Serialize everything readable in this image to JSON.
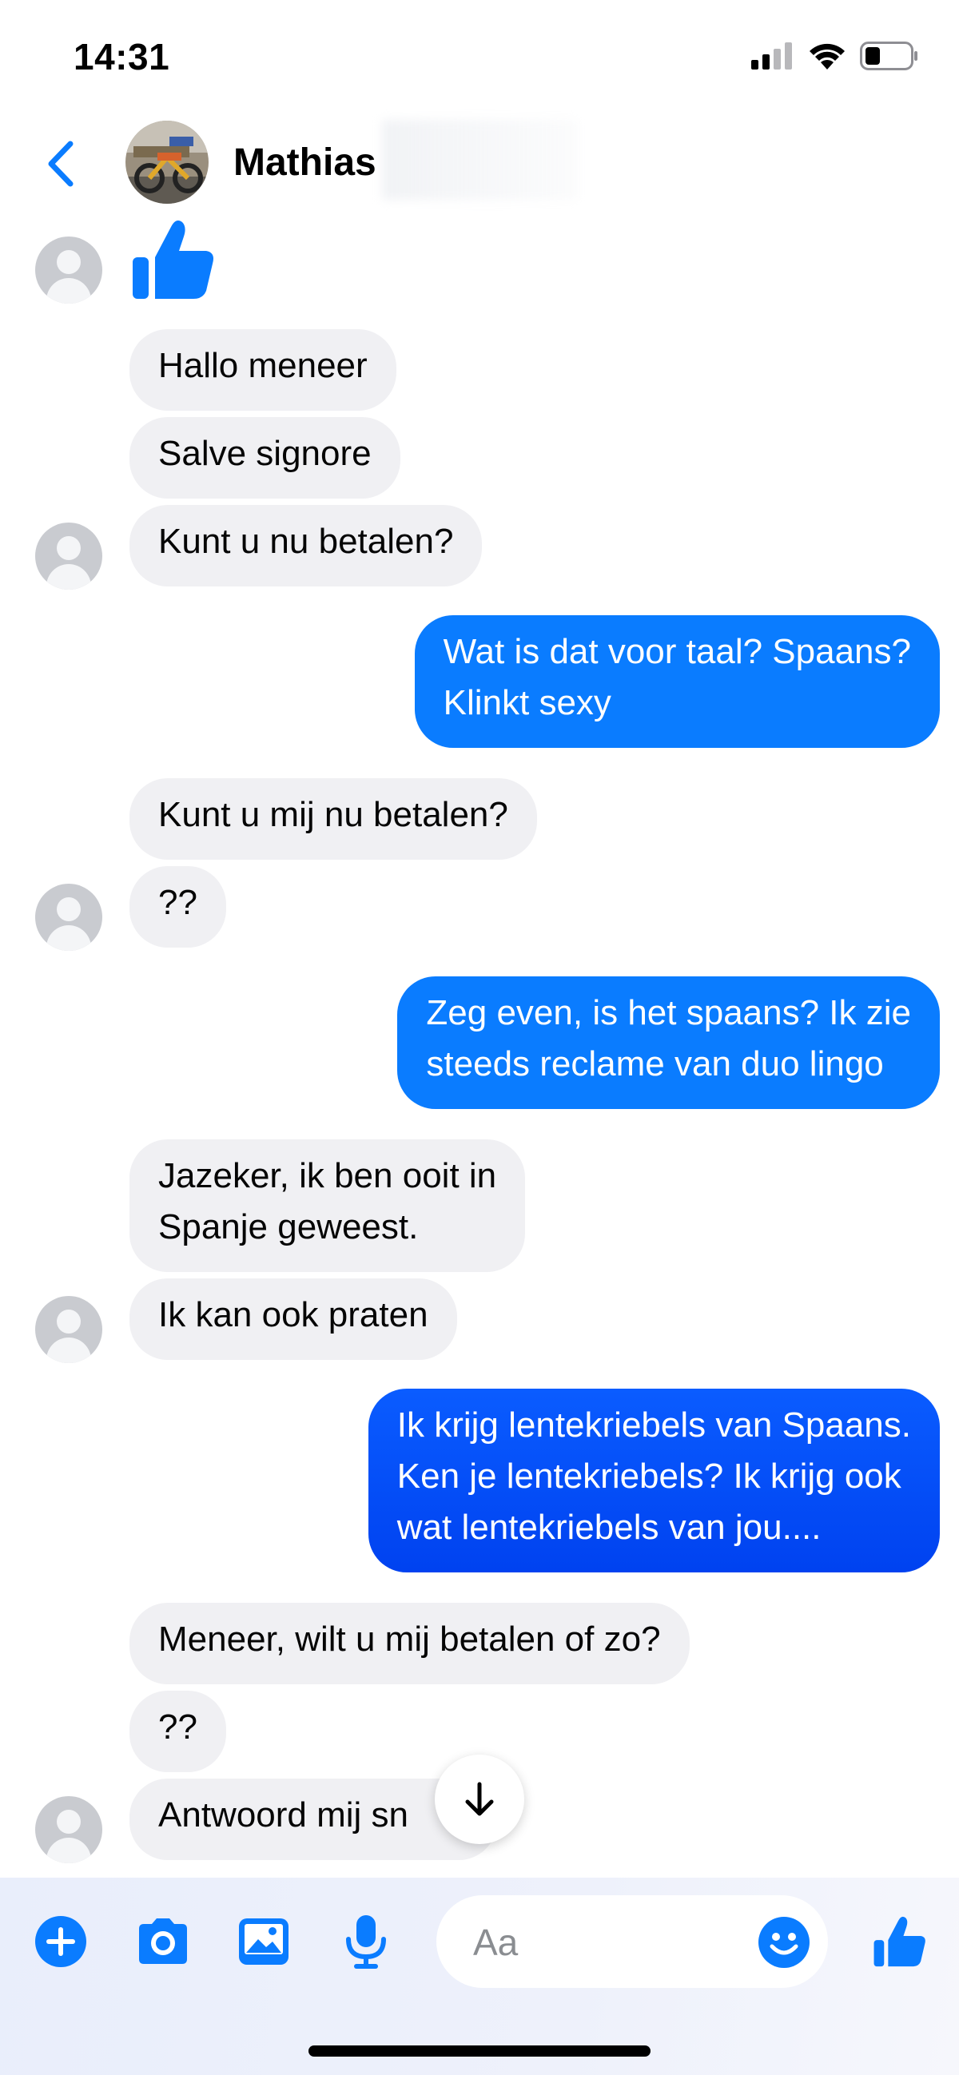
{
  "status_bar": {
    "time": "14:31"
  },
  "header": {
    "contact_name": "Mathias"
  },
  "messages": [
    {
      "side": "in",
      "text": "Hallo meneer"
    },
    {
      "side": "in",
      "text": "Salve signore"
    },
    {
      "side": "in",
      "text": "Kunt u nu betalen?"
    },
    {
      "side": "out",
      "text": "Wat is dat voor taal? Spaans?\nKlinkt sexy"
    },
    {
      "side": "in",
      "text": "Kunt u mij nu betalen?"
    },
    {
      "side": "in",
      "text": "??"
    },
    {
      "side": "out",
      "text": "Zeg even, is het spaans? Ik zie\nsteeds reclame van duo lingo"
    },
    {
      "side": "in",
      "text": "Jazeker, ik ben ooit in\nSpanje geweest."
    },
    {
      "side": "in",
      "text": "Ik kan ook praten"
    },
    {
      "side": "out",
      "text": "Ik krijg lentekriebels van Spaans.\nKen je lentekriebels? Ik krijg ook\nwat lentekriebels van jou...."
    },
    {
      "side": "in",
      "text": "Meneer, wilt u mij betalen of zo?"
    },
    {
      "side": "in",
      "text": "??"
    },
    {
      "side": "in",
      "text": "Antwoord mij sn"
    }
  ],
  "composer": {
    "placeholder": "Aa"
  },
  "colors": {
    "accent": "#0a7cff",
    "incoming_bubble": "#f0f0f3",
    "outgoing_bubble": "#0a7cff"
  },
  "icons": [
    "back-chevron-icon",
    "thumbs-up-icon",
    "plus-icon",
    "camera-icon",
    "gallery-icon",
    "microphone-icon",
    "emoji-icon",
    "arrow-down-icon"
  ]
}
